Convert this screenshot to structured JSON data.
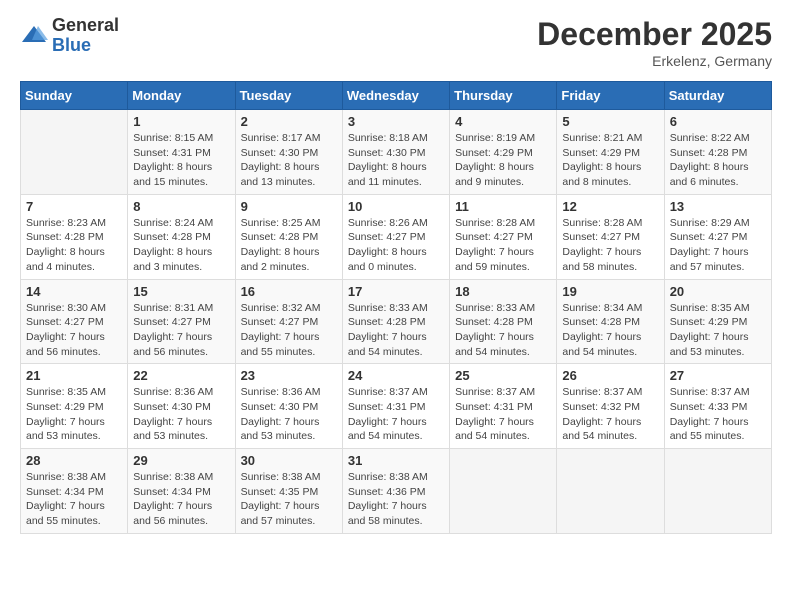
{
  "header": {
    "logo_general": "General",
    "logo_blue": "Blue",
    "month_title": "December 2025",
    "subtitle": "Erkelenz, Germany"
  },
  "calendar": {
    "days_of_week": [
      "Sunday",
      "Monday",
      "Tuesday",
      "Wednesday",
      "Thursday",
      "Friday",
      "Saturday"
    ],
    "weeks": [
      [
        {
          "day": "",
          "info": ""
        },
        {
          "day": "1",
          "info": "Sunrise: 8:15 AM\nSunset: 4:31 PM\nDaylight: 8 hours\nand 15 minutes."
        },
        {
          "day": "2",
          "info": "Sunrise: 8:17 AM\nSunset: 4:30 PM\nDaylight: 8 hours\nand 13 minutes."
        },
        {
          "day": "3",
          "info": "Sunrise: 8:18 AM\nSunset: 4:30 PM\nDaylight: 8 hours\nand 11 minutes."
        },
        {
          "day": "4",
          "info": "Sunrise: 8:19 AM\nSunset: 4:29 PM\nDaylight: 8 hours\nand 9 minutes."
        },
        {
          "day": "5",
          "info": "Sunrise: 8:21 AM\nSunset: 4:29 PM\nDaylight: 8 hours\nand 8 minutes."
        },
        {
          "day": "6",
          "info": "Sunrise: 8:22 AM\nSunset: 4:28 PM\nDaylight: 8 hours\nand 6 minutes."
        }
      ],
      [
        {
          "day": "7",
          "info": "Sunrise: 8:23 AM\nSunset: 4:28 PM\nDaylight: 8 hours\nand 4 minutes."
        },
        {
          "day": "8",
          "info": "Sunrise: 8:24 AM\nSunset: 4:28 PM\nDaylight: 8 hours\nand 3 minutes."
        },
        {
          "day": "9",
          "info": "Sunrise: 8:25 AM\nSunset: 4:28 PM\nDaylight: 8 hours\nand 2 minutes."
        },
        {
          "day": "10",
          "info": "Sunrise: 8:26 AM\nSunset: 4:27 PM\nDaylight: 8 hours\nand 0 minutes."
        },
        {
          "day": "11",
          "info": "Sunrise: 8:28 AM\nSunset: 4:27 PM\nDaylight: 7 hours\nand 59 minutes."
        },
        {
          "day": "12",
          "info": "Sunrise: 8:28 AM\nSunset: 4:27 PM\nDaylight: 7 hours\nand 58 minutes."
        },
        {
          "day": "13",
          "info": "Sunrise: 8:29 AM\nSunset: 4:27 PM\nDaylight: 7 hours\nand 57 minutes."
        }
      ],
      [
        {
          "day": "14",
          "info": "Sunrise: 8:30 AM\nSunset: 4:27 PM\nDaylight: 7 hours\nand 56 minutes."
        },
        {
          "day": "15",
          "info": "Sunrise: 8:31 AM\nSunset: 4:27 PM\nDaylight: 7 hours\nand 56 minutes."
        },
        {
          "day": "16",
          "info": "Sunrise: 8:32 AM\nSunset: 4:27 PM\nDaylight: 7 hours\nand 55 minutes."
        },
        {
          "day": "17",
          "info": "Sunrise: 8:33 AM\nSunset: 4:28 PM\nDaylight: 7 hours\nand 54 minutes."
        },
        {
          "day": "18",
          "info": "Sunrise: 8:33 AM\nSunset: 4:28 PM\nDaylight: 7 hours\nand 54 minutes."
        },
        {
          "day": "19",
          "info": "Sunrise: 8:34 AM\nSunset: 4:28 PM\nDaylight: 7 hours\nand 54 minutes."
        },
        {
          "day": "20",
          "info": "Sunrise: 8:35 AM\nSunset: 4:29 PM\nDaylight: 7 hours\nand 53 minutes."
        }
      ],
      [
        {
          "day": "21",
          "info": "Sunrise: 8:35 AM\nSunset: 4:29 PM\nDaylight: 7 hours\nand 53 minutes."
        },
        {
          "day": "22",
          "info": "Sunrise: 8:36 AM\nSunset: 4:30 PM\nDaylight: 7 hours\nand 53 minutes."
        },
        {
          "day": "23",
          "info": "Sunrise: 8:36 AM\nSunset: 4:30 PM\nDaylight: 7 hours\nand 53 minutes."
        },
        {
          "day": "24",
          "info": "Sunrise: 8:37 AM\nSunset: 4:31 PM\nDaylight: 7 hours\nand 54 minutes."
        },
        {
          "day": "25",
          "info": "Sunrise: 8:37 AM\nSunset: 4:31 PM\nDaylight: 7 hours\nand 54 minutes."
        },
        {
          "day": "26",
          "info": "Sunrise: 8:37 AM\nSunset: 4:32 PM\nDaylight: 7 hours\nand 54 minutes."
        },
        {
          "day": "27",
          "info": "Sunrise: 8:37 AM\nSunset: 4:33 PM\nDaylight: 7 hours\nand 55 minutes."
        }
      ],
      [
        {
          "day": "28",
          "info": "Sunrise: 8:38 AM\nSunset: 4:34 PM\nDaylight: 7 hours\nand 55 minutes."
        },
        {
          "day": "29",
          "info": "Sunrise: 8:38 AM\nSunset: 4:34 PM\nDaylight: 7 hours\nand 56 minutes."
        },
        {
          "day": "30",
          "info": "Sunrise: 8:38 AM\nSunset: 4:35 PM\nDaylight: 7 hours\nand 57 minutes."
        },
        {
          "day": "31",
          "info": "Sunrise: 8:38 AM\nSunset: 4:36 PM\nDaylight: 7 hours\nand 58 minutes."
        },
        {
          "day": "",
          "info": ""
        },
        {
          "day": "",
          "info": ""
        },
        {
          "day": "",
          "info": ""
        }
      ]
    ]
  }
}
